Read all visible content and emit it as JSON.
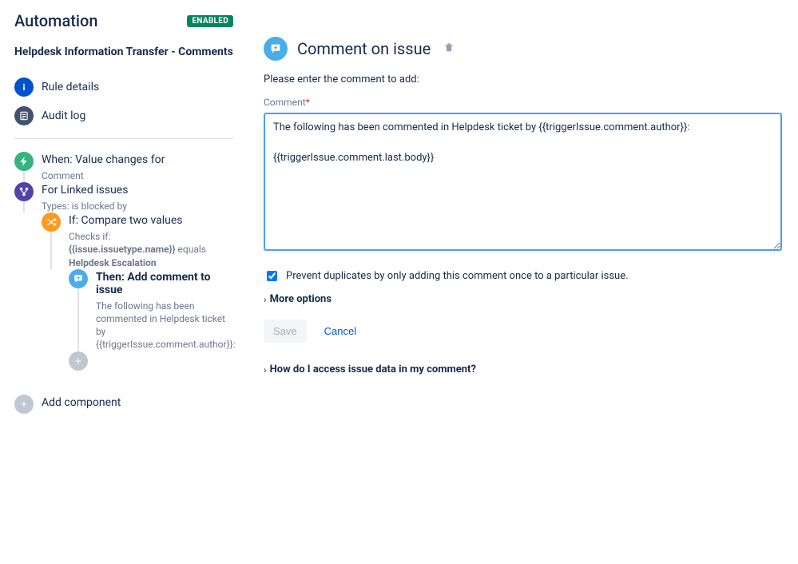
{
  "header": {
    "title": "Automation",
    "status_badge": "ENABLED",
    "rule_name": "Helpdesk Information Transfer - Comments"
  },
  "menu": {
    "rule_details": "Rule details",
    "audit_log": "Audit log"
  },
  "tree": {
    "trigger": {
      "title": "When: Value changes for",
      "sub": "Comment"
    },
    "branch": {
      "title": "For Linked issues",
      "sub": "Types: is blocked by"
    },
    "condition": {
      "title": "If: Compare two values",
      "sub_lead": "Checks if:",
      "sub_expr": "{{issue.issuetype.name}}",
      "sub_op": "equals",
      "sub_value": "Helpdesk Escalation"
    },
    "action": {
      "title": "Then: Add comment to issue",
      "sub": "The following has been commented in Helpdesk ticket by {{triggerIssue.comment.author}}:"
    },
    "add_component": "Add component"
  },
  "panel": {
    "title": "Comment on issue",
    "hint": "Please enter the comment to add:",
    "field_label": "Comment",
    "comment_value": "The following has been commented in Helpdesk ticket by {{triggerIssue.comment.author}}:\n\n{{triggerIssue.comment.last.body}}",
    "prevent_dup_checked": true,
    "prevent_dup_label": "Prevent duplicates by only adding this comment once to a particular issue.",
    "more_options": "More options",
    "save": "Save",
    "cancel": "Cancel",
    "help_link": "How do I access issue data in my comment?"
  }
}
